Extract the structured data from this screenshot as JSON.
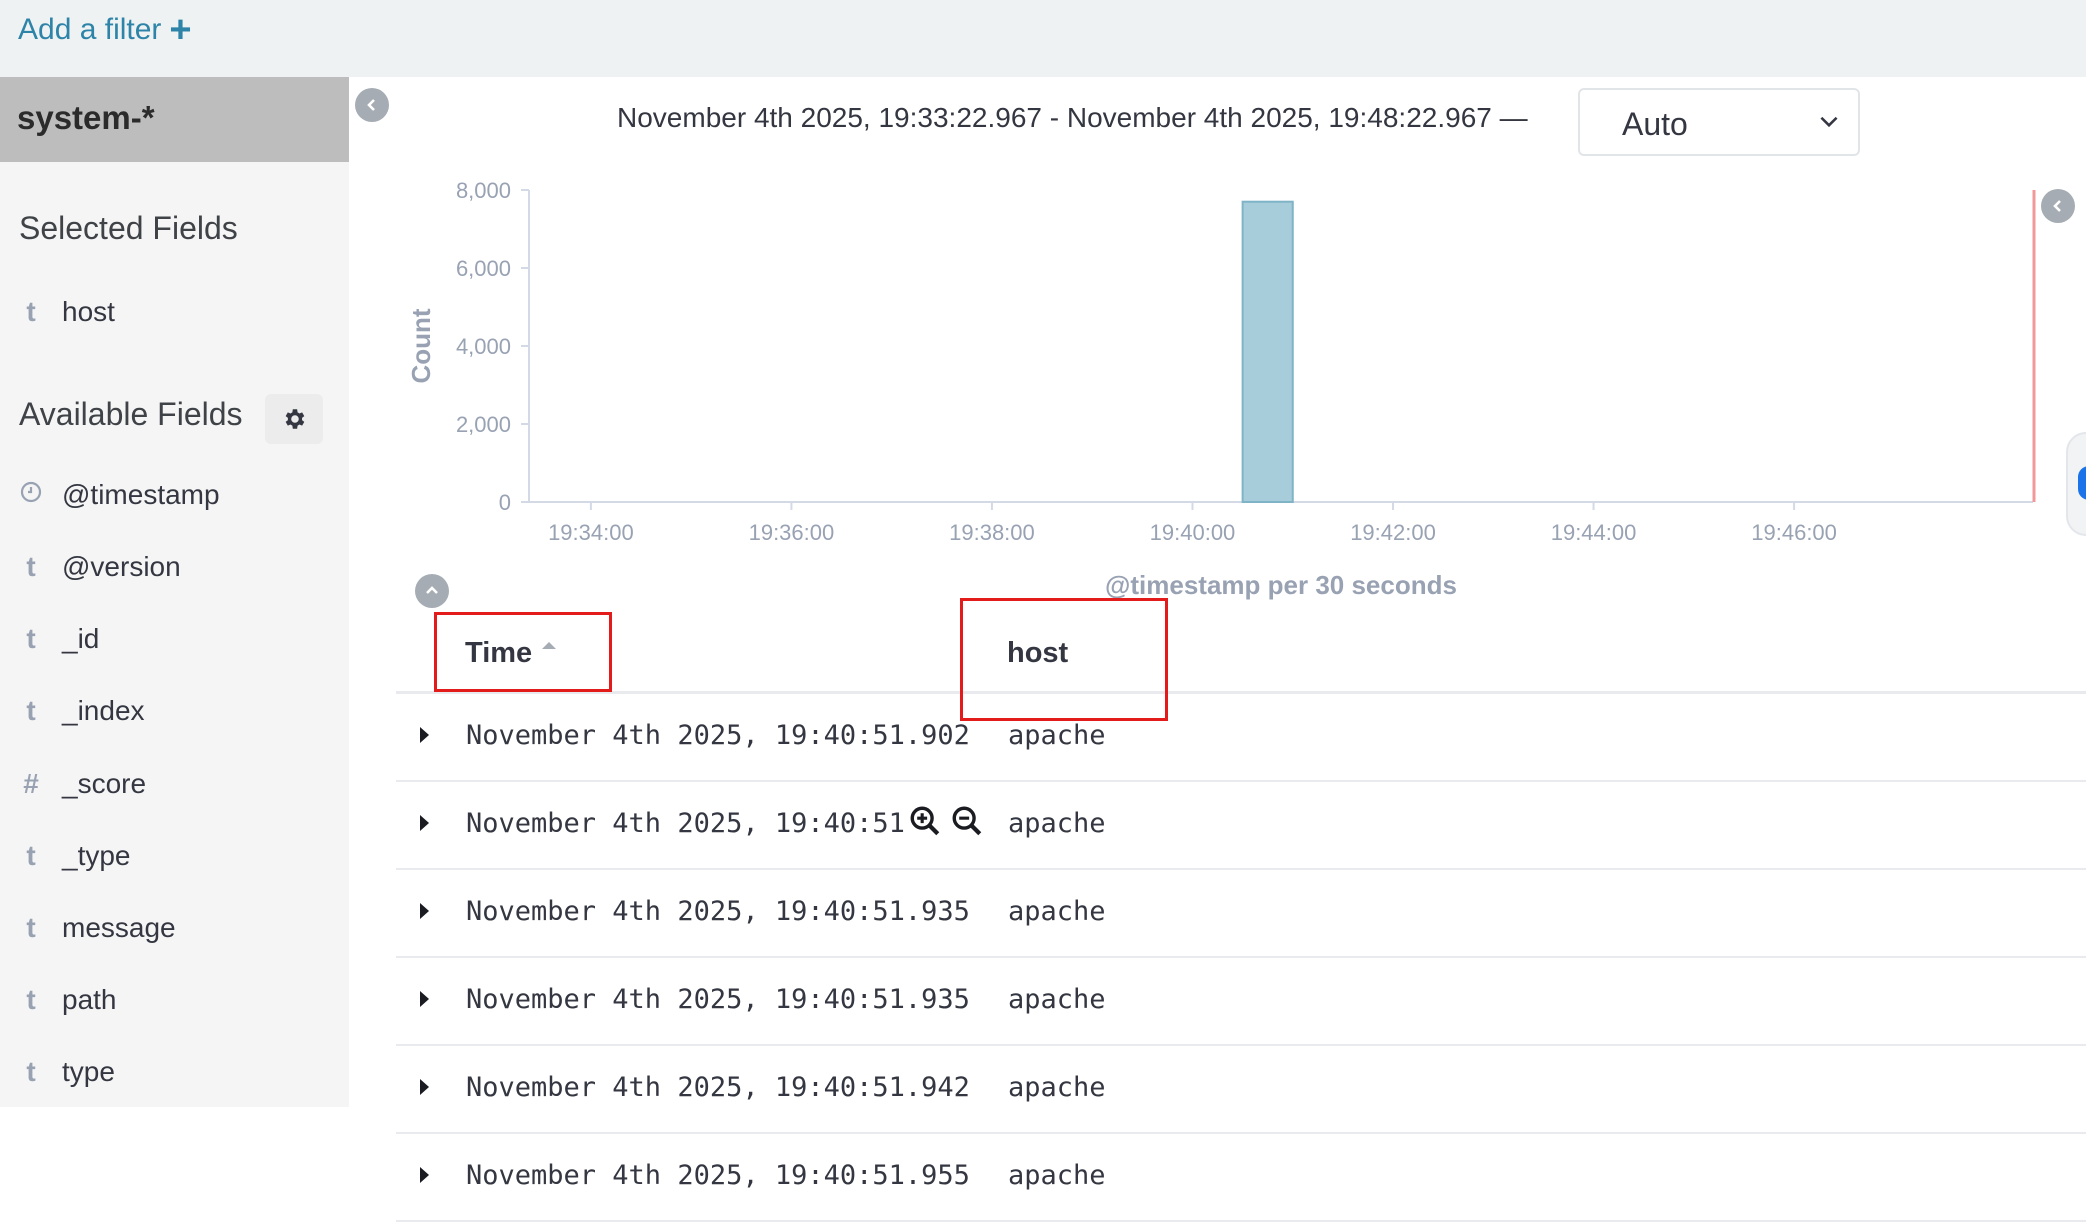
{
  "filter_bar": {
    "add_filter_label": "Add a filter",
    "add_filter_icon": "plus-icon"
  },
  "sidebar": {
    "index_pattern": "system-*",
    "selected_fields_title": "Selected Fields",
    "selected_fields": [
      {
        "type": "t",
        "name": "host"
      }
    ],
    "available_fields_title": "Available Fields",
    "available_fields": [
      {
        "type": "clock",
        "name": "@timestamp"
      },
      {
        "type": "t",
        "name": "@version"
      },
      {
        "type": "t",
        "name": "_id"
      },
      {
        "type": "t",
        "name": "_index"
      },
      {
        "type": "#",
        "name": "_score"
      },
      {
        "type": "t",
        "name": "_type"
      },
      {
        "type": "t",
        "name": "message"
      },
      {
        "type": "t",
        "name": "path"
      },
      {
        "type": "t",
        "name": "type"
      }
    ]
  },
  "header": {
    "time_range": "November 4th 2025, 19:33:22.967 - November 4th 2025, 19:48:22.967 —",
    "interval": "Auto"
  },
  "chart_data": {
    "type": "bar",
    "xlabel": "@timestamp per 30 seconds",
    "ylabel": "Count",
    "ylim": [
      0,
      8000
    ],
    "y_ticks": [
      "0",
      "2,000",
      "4,000",
      "6,000",
      "8,000"
    ],
    "x_ticks": [
      "19:34:00",
      "19:36:00",
      "19:38:00",
      "19:40:00",
      "19:42:00",
      "19:44:00",
      "19:46:00"
    ],
    "x_range": [
      "19:33:22.967",
      "19:48:22.967"
    ],
    "bars": [
      {
        "start": "19:40:30",
        "end": "19:41:00",
        "value": 7700
      }
    ],
    "bar_color": "#a6cdd9",
    "grid": false
  },
  "table": {
    "columns": [
      {
        "label": "Time",
        "sort": "ascending"
      },
      {
        "label": "host"
      }
    ],
    "rows": [
      {
        "time": "November 4th 2025, 19:40:51.902",
        "host": "apache"
      },
      {
        "time": "November 4th 2025, 19:40:51",
        "host": "apache"
      },
      {
        "time": "November 4th 2025, 19:40:51.935",
        "host": "apache"
      },
      {
        "time": "November 4th 2025, 19:40:51.935",
        "host": "apache"
      },
      {
        "time": "November 4th 2025, 19:40:51.942",
        "host": "apache"
      },
      {
        "time": "November 4th 2025, 19:40:51.955",
        "host": "apache"
      }
    ]
  },
  "colors": {
    "accent": "#2d84a8",
    "highlight_box": "#e41b1b"
  }
}
